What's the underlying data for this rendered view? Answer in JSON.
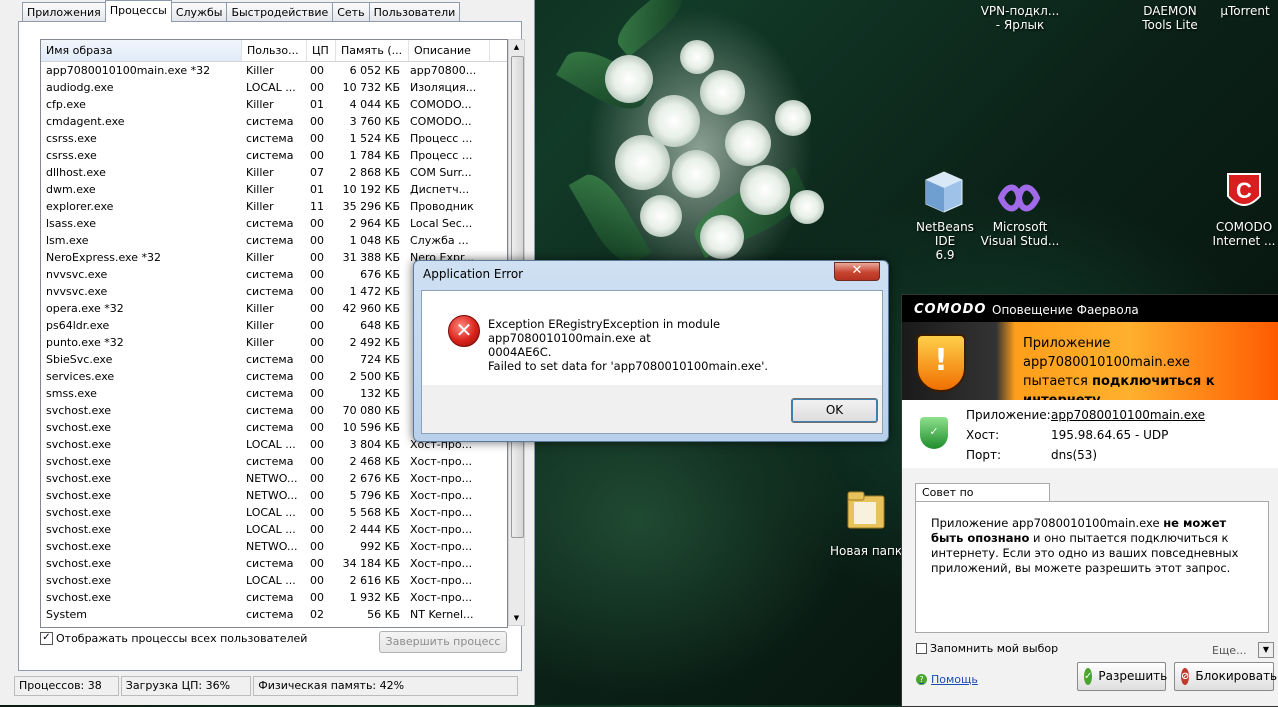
{
  "task_manager": {
    "tabs": [
      "Приложения",
      "Процессы",
      "Службы",
      "Быстродействие",
      "Сеть",
      "Пользователи"
    ],
    "active_tab": "Процессы",
    "columns": [
      "Имя образа",
      "Пользо...",
      "ЦП",
      "Память (...",
      "Описание"
    ],
    "rows": [
      {
        "name": "app7080010100main.exe *32",
        "user": "Killer",
        "cpu": "00",
        "mem": "6 052 КБ",
        "desc": "app70800..."
      },
      {
        "name": "audiodg.exe",
        "user": "LOCAL ...",
        "cpu": "00",
        "mem": "10 732 КБ",
        "desc": "Изоляция..."
      },
      {
        "name": "cfp.exe",
        "user": "Killer",
        "cpu": "01",
        "mem": "4 044 КБ",
        "desc": "COMODO..."
      },
      {
        "name": "cmdagent.exe",
        "user": "система",
        "cpu": "00",
        "mem": "3 760 КБ",
        "desc": "COMODO..."
      },
      {
        "name": "csrss.exe",
        "user": "система",
        "cpu": "00",
        "mem": "1 524 КБ",
        "desc": "Процесс ..."
      },
      {
        "name": "csrss.exe",
        "user": "система",
        "cpu": "00",
        "mem": "1 784 КБ",
        "desc": "Процесс ..."
      },
      {
        "name": "dllhost.exe",
        "user": "Killer",
        "cpu": "07",
        "mem": "2 868 КБ",
        "desc": "COM Surr..."
      },
      {
        "name": "dwm.exe",
        "user": "Killer",
        "cpu": "01",
        "mem": "10 192 КБ",
        "desc": "Диспетч..."
      },
      {
        "name": "explorer.exe",
        "user": "Killer",
        "cpu": "11",
        "mem": "35 296 КБ",
        "desc": "Проводник"
      },
      {
        "name": "lsass.exe",
        "user": "система",
        "cpu": "00",
        "mem": "2 964 КБ",
        "desc": "Local Sec..."
      },
      {
        "name": "lsm.exe",
        "user": "система",
        "cpu": "00",
        "mem": "1 048 КБ",
        "desc": "Служба ..."
      },
      {
        "name": "NeroExpress.exe *32",
        "user": "Killer",
        "cpu": "00",
        "mem": "31 388 КБ",
        "desc": "Nero Expr..."
      },
      {
        "name": "nvvsvc.exe",
        "user": "система",
        "cpu": "00",
        "mem": "676 КБ",
        "desc": ""
      },
      {
        "name": "nvvsvc.exe",
        "user": "система",
        "cpu": "00",
        "mem": "1 472 КБ",
        "desc": ""
      },
      {
        "name": "opera.exe *32",
        "user": "Killer",
        "cpu": "00",
        "mem": "42 960 КБ",
        "desc": ""
      },
      {
        "name": "ps64ldr.exe",
        "user": "Killer",
        "cpu": "00",
        "mem": "648 КБ",
        "desc": ""
      },
      {
        "name": "punto.exe *32",
        "user": "Killer",
        "cpu": "00",
        "mem": "2 492 КБ",
        "desc": ""
      },
      {
        "name": "SbieSvc.exe",
        "user": "система",
        "cpu": "00",
        "mem": "724 КБ",
        "desc": ""
      },
      {
        "name": "services.exe",
        "user": "система",
        "cpu": "00",
        "mem": "2 500 КБ",
        "desc": ""
      },
      {
        "name": "smss.exe",
        "user": "система",
        "cpu": "00",
        "mem": "132 КБ",
        "desc": ""
      },
      {
        "name": "svchost.exe",
        "user": "система",
        "cpu": "00",
        "mem": "70 080 КБ",
        "desc": ""
      },
      {
        "name": "svchost.exe",
        "user": "система",
        "cpu": "00",
        "mem": "10 596 КБ",
        "desc": ""
      },
      {
        "name": "svchost.exe",
        "user": "LOCAL ...",
        "cpu": "00",
        "mem": "3 804 КБ",
        "desc": "Хост-про..."
      },
      {
        "name": "svchost.exe",
        "user": "система",
        "cpu": "00",
        "mem": "2 468 КБ",
        "desc": "Хост-про..."
      },
      {
        "name": "svchost.exe",
        "user": "NETWO...",
        "cpu": "00",
        "mem": "2 676 КБ",
        "desc": "Хост-про..."
      },
      {
        "name": "svchost.exe",
        "user": "NETWO...",
        "cpu": "00",
        "mem": "5 796 КБ",
        "desc": "Хост-про..."
      },
      {
        "name": "svchost.exe",
        "user": "LOCAL ...",
        "cpu": "00",
        "mem": "5 568 КБ",
        "desc": "Хост-про..."
      },
      {
        "name": "svchost.exe",
        "user": "LOCAL ...",
        "cpu": "00",
        "mem": "2 444 КБ",
        "desc": "Хост-про..."
      },
      {
        "name": "svchost.exe",
        "user": "NETWO...",
        "cpu": "00",
        "mem": "992 КБ",
        "desc": "Хост-про..."
      },
      {
        "name": "svchost.exe",
        "user": "система",
        "cpu": "00",
        "mem": "34 184 КБ",
        "desc": "Хост-про..."
      },
      {
        "name": "svchost.exe",
        "user": "LOCAL ...",
        "cpu": "00",
        "mem": "2 616 КБ",
        "desc": "Хост-про..."
      },
      {
        "name": "svchost.exe",
        "user": "система",
        "cpu": "00",
        "mem": "1 932 КБ",
        "desc": "Хост-про..."
      },
      {
        "name": "System",
        "user": "система",
        "cpu": "02",
        "mem": "56 КБ",
        "desc": "NT Kernel..."
      }
    ],
    "show_all_label": "Отображать процессы всех пользователей",
    "end_process_label": "Завершить процесс",
    "status_processes": "Процессов: 38",
    "status_cpu": "Загрузка ЦП: 36%",
    "status_memory": "Физическая память: 42%"
  },
  "desktop": {
    "vpn_label_1": "VPN-подкл...",
    "vpn_label_2": "- Ярлык",
    "daemon_label_1": "DAEMON",
    "daemon_label_2": "Tools Lite",
    "utorrent_label": "µTorrent",
    "netbeans_label_1": "NetBeans IDE",
    "netbeans_label_2": "6.9",
    "vs_label_1": "Microsoft",
    "vs_label_2": "Visual Stud...",
    "comodo_label_1": "COMODO",
    "comodo_label_2": "Internet ...",
    "folder_label": "Новая папка"
  },
  "error_dialog": {
    "title": "Application Error",
    "close_glyph": "✕",
    "line1": "Exception ERegistryException in module app7080010100main.exe at",
    "line2": "0004AE6C.",
    "line3": "Failed to set data for 'app7080010100main.exe'.",
    "ok_label": "OK"
  },
  "comodo": {
    "logo": "COMODO",
    "header": "Оповещение Фаервола",
    "banner_1": "Приложение app7080010100main.exe",
    "banner_2a": "пытается ",
    "banner_2b": "подключиться к",
    "banner_3b": "интернету",
    "banner_3c": ".",
    "app_label": "Приложение:",
    "app_value": "app7080010100main.exe",
    "host_label": "Хост:",
    "host_value": "195.98.64.65 - UDP",
    "port_label": "Порт:",
    "port_value": "dns(53)",
    "advice_tab": "Совет по безопасности",
    "advice_1": "Приложение app7080010100main.exe ",
    "advice_2": "не может быть опознано",
    "advice_3": " и оно пытается подключиться к интернету. Если это одно из ваших повседневных приложений, вы можете разрешить этот запрос.",
    "remember_label": "Запомнить мой выбор",
    "more_label": "Еще...",
    "help_label": "Помощь",
    "allow_label": "Разрешить",
    "block_label": "Блокировать"
  },
  "colors": {
    "comodo_banner": "#ff9e1a",
    "error_red": "#d9231b",
    "allow_green": "#4aa52e",
    "block_red": "#c0392b"
  }
}
